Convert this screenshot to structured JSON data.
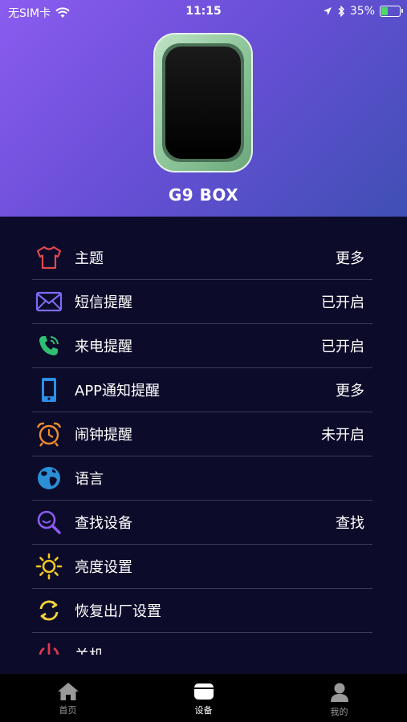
{
  "status_bar": {
    "carrier": "无SIM卡",
    "time": "11:15",
    "battery_percent": "35%",
    "battery_level": 0.35
  },
  "device": {
    "name": "G9 BOX"
  },
  "menu": {
    "items": [
      {
        "label": "主题",
        "value": "更多",
        "icon": "tshirt-icon",
        "color": "#e0494e"
      },
      {
        "label": "短信提醒",
        "value": "已开启",
        "icon": "envelope-icon",
        "color": "#7b6cf2"
      },
      {
        "label": "来电提醒",
        "value": "已开启",
        "icon": "phone-icon",
        "color": "#2fbf71"
      },
      {
        "label": "APP通知提醒",
        "value": "更多",
        "icon": "smartphone-icon",
        "color": "#2d8fe6"
      },
      {
        "label": "闹钟提醒",
        "value": "未开启",
        "icon": "alarm-clock-icon",
        "color": "#f08a2b"
      },
      {
        "label": "语言",
        "value": "",
        "icon": "globe-icon",
        "color": "#2a8fd6"
      },
      {
        "label": "查找设备",
        "value": "查找",
        "icon": "search-icon",
        "color": "#8b5cf0"
      },
      {
        "label": "亮度设置",
        "value": "",
        "icon": "sun-icon",
        "color": "#f3c623"
      },
      {
        "label": "恢复出厂设置",
        "value": "",
        "icon": "refresh-icon",
        "color": "#f3d23a"
      },
      {
        "label": "关机",
        "value": "",
        "icon": "power-icon",
        "color": "#e0394e"
      }
    ]
  },
  "tabbar": {
    "tabs": [
      {
        "label": "首页",
        "icon": "home-icon"
      },
      {
        "label": "设备",
        "icon": "device-icon"
      },
      {
        "label": "我的",
        "icon": "profile-icon"
      }
    ]
  }
}
